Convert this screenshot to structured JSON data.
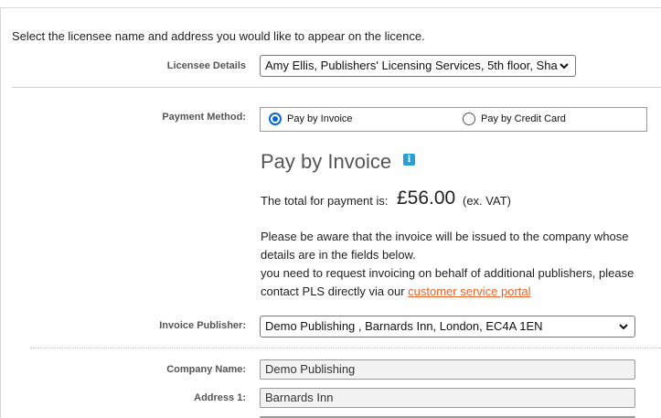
{
  "intro_text": "Select the licensee name and address you would like to appear on the licence.",
  "licensee": {
    "label": "Licensee Details",
    "selected": "Amy Ellis, Publishers' Licensing Services, 5th floor, Sha"
  },
  "payment": {
    "label": "Payment Method:",
    "options": [
      {
        "label": "Pay by Invoice",
        "checked": true
      },
      {
        "label": "Pay by Credit Card",
        "checked": false
      }
    ]
  },
  "invoice": {
    "heading": "Pay by Invoice",
    "info_icon": "i",
    "total_label": "The total for payment is:",
    "amount": "£56.00",
    "vat_note": "(ex. VAT)",
    "notice_line1": "Please be aware that the invoice will be issued to the company whose",
    "notice_line2": "details are in the fields below.",
    "notice_line3": "you need to request invoicing on behalf of additional publishers, please",
    "notice_line4_prefix": "contact PLS directly via our ",
    "notice_link": "customer service portal"
  },
  "publisher": {
    "label": "Invoice Publisher:",
    "selected": "Demo Publishing , Barnards Inn, London, EC4A 1EN"
  },
  "company": {
    "label": "Company Name:",
    "value": "Demo Publishing"
  },
  "address1": {
    "label": "Address 1:",
    "value": "Barnards Inn"
  },
  "colors": {
    "accent": "#0a67d2",
    "link": "#e8632c",
    "info": "#2a9ed8"
  }
}
